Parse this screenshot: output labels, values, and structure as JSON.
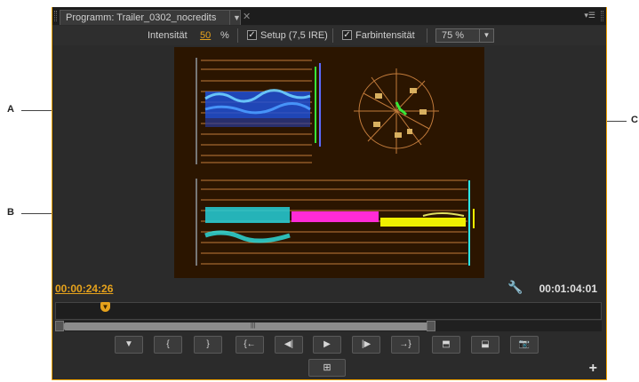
{
  "callouts": {
    "a": "A",
    "b": "B",
    "c": "C"
  },
  "panel": {
    "tab_title": "Programm: Trailer_0302_nocredits",
    "tab_menu_icon": "chevron-down-icon",
    "close_icon": "close-icon",
    "panel_menu_icon": "panel-menu-icon"
  },
  "options": {
    "intensity_label": "Intensität",
    "intensity_value": "50",
    "intensity_unit": "%",
    "setup_label": "Setup (7,5 IRE)",
    "setup_checked": true,
    "chroma_label": "Farbintensität",
    "chroma_checked": true,
    "zoom_value": "75 %"
  },
  "timecode": {
    "current": "00:00:24:26",
    "duration": "00:01:04:01"
  },
  "transport": {
    "buttons": [
      "add-marker-icon",
      "mark-in-icon",
      "mark-out-icon",
      "go-to-in-icon",
      "step-back-icon",
      "play-icon",
      "step-forward-icon",
      "go-to-out-icon",
      "lift-icon",
      "extract-icon",
      "export-frame-icon"
    ],
    "safe_margins_icon": "safe-margins-icon",
    "add_button_icon": "plus-icon"
  },
  "colors": {
    "accent": "#e6a21c",
    "panel_bg": "#2b2b2b",
    "scope_bg": "#2b1500",
    "graticule": "#c07a3a",
    "luma_wave": "#2f7bff",
    "parade_cyan": "#2ee6e6",
    "parade_magenta": "#ff2bd6",
    "parade_yellow": "#f0f000",
    "vector_green": "#38e838"
  }
}
